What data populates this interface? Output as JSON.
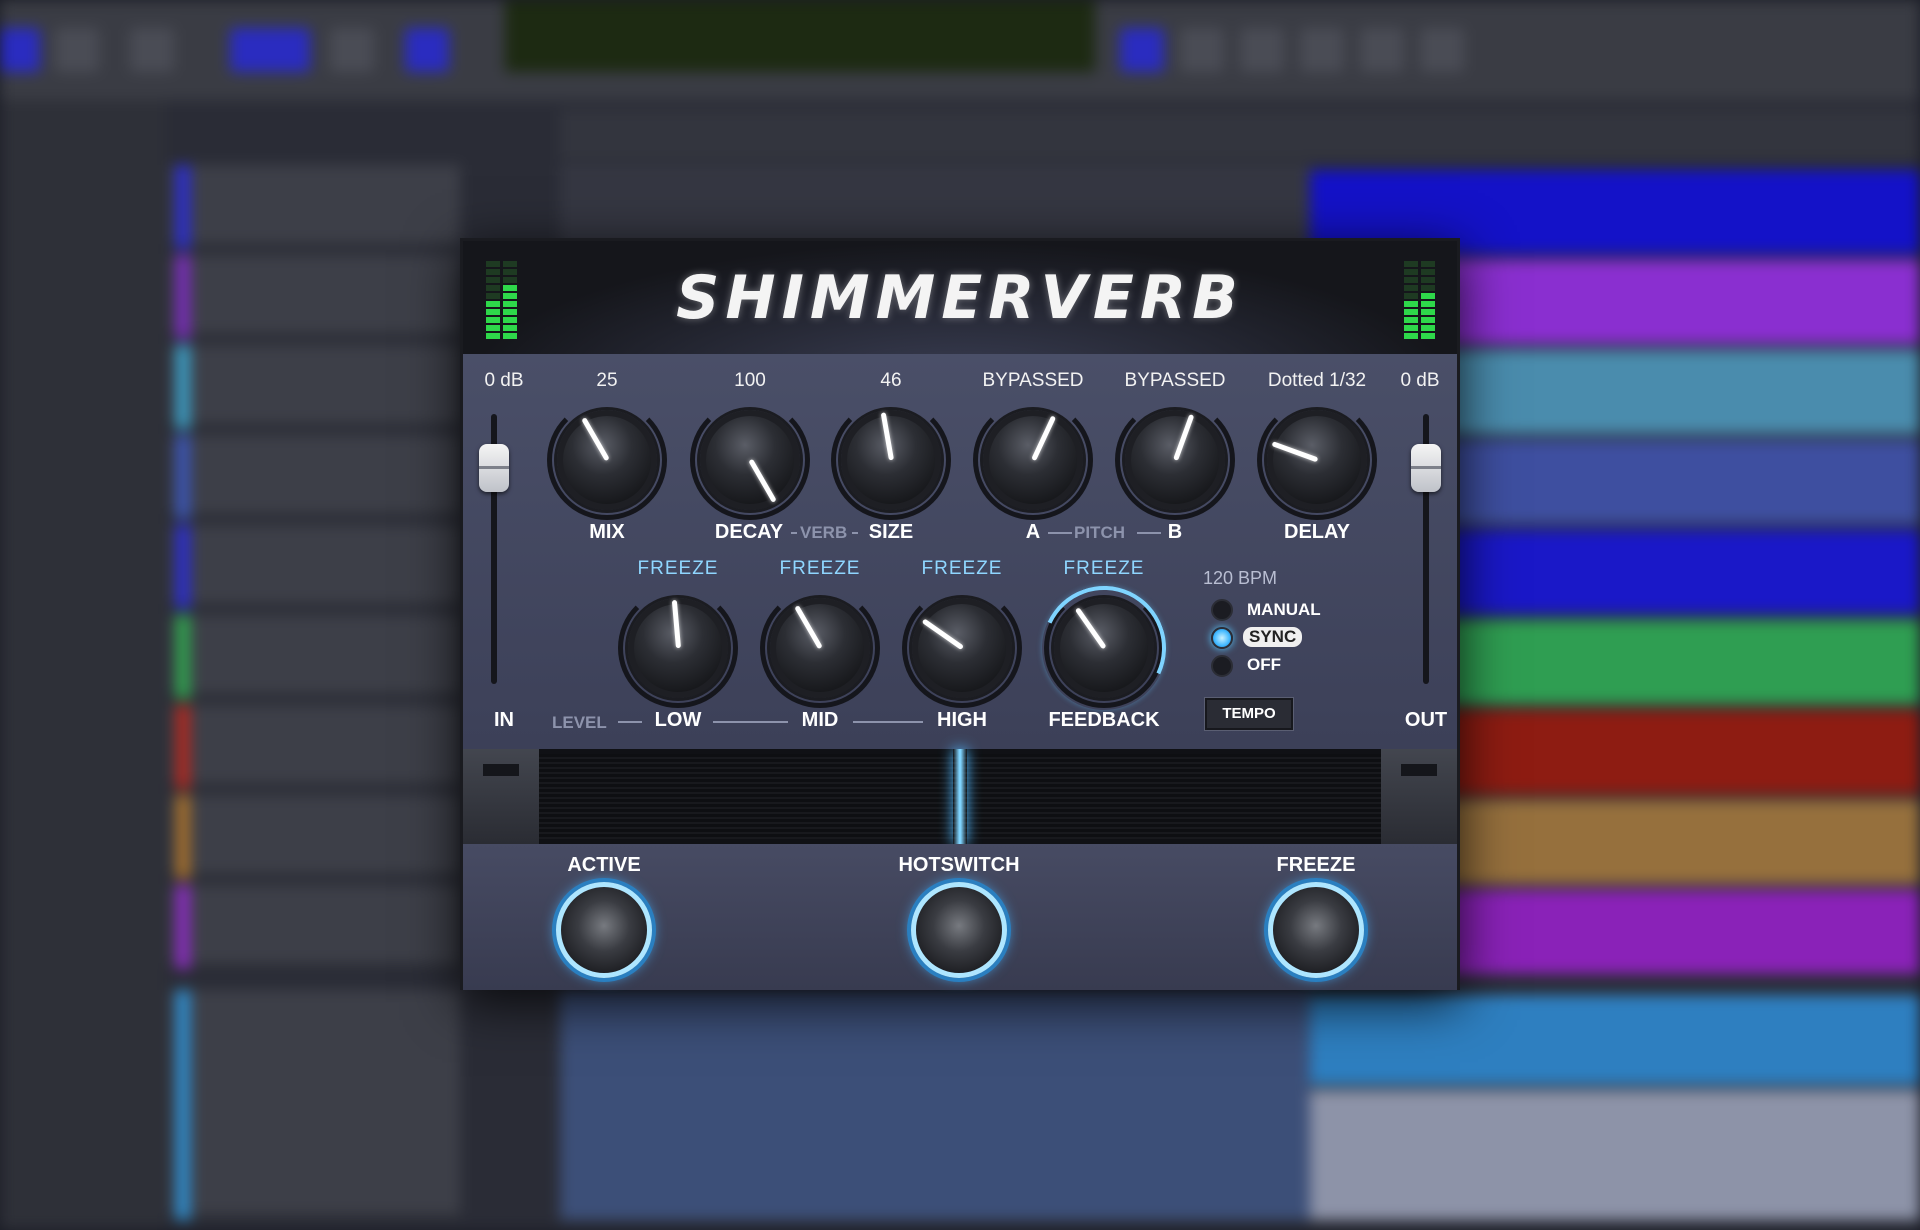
{
  "plugin": {
    "title": "SHIMMERVERB",
    "in_value": "0 dB",
    "out_value": "0 dB",
    "in_label": "IN",
    "out_label": "OUT",
    "knobs": {
      "mix": {
        "value": "25",
        "label": "MIX"
      },
      "decay": {
        "value": "100",
        "label": "DECAY"
      },
      "size": {
        "value": "46",
        "label": "SIZE"
      },
      "pitch_a": {
        "value": "BYPASSED",
        "label": "A"
      },
      "pitch_b": {
        "value": "BYPASSED",
        "label": "B"
      },
      "delay": {
        "value": "Dotted 1/32",
        "label": "DELAY"
      }
    },
    "group_labels": {
      "verb": "VERB",
      "pitch": "PITCH",
      "level": "LEVEL"
    },
    "eq": {
      "low": {
        "freeze": "FREEZE",
        "label": "LOW"
      },
      "mid": {
        "freeze": "FREEZE",
        "label": "MID"
      },
      "high": {
        "freeze": "FREEZE",
        "label": "HIGH"
      },
      "feedback": {
        "freeze": "FREEZE",
        "label": "FEEDBACK"
      }
    },
    "tempo": {
      "bpm": "120 BPM",
      "options": [
        "MANUAL",
        "SYNC",
        "OFF"
      ],
      "selected": "SYNC",
      "button": "TEMPO"
    },
    "footswitches": {
      "active": "ACTIVE",
      "hotswitch": "HOTSWITCH",
      "freeze": "FREEZE"
    },
    "colors": {
      "accent": "#58c8ff",
      "meter": "#2ed84a",
      "panel": "#454a62"
    }
  }
}
